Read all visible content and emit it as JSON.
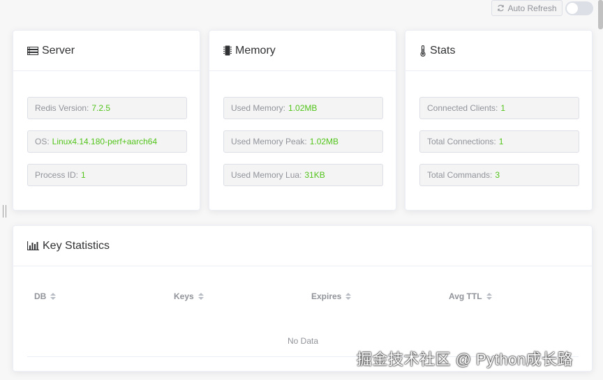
{
  "toolbar": {
    "auto_refresh_label": "Auto Refresh",
    "auto_refresh_enabled": false
  },
  "server": {
    "title": "Server",
    "items": [
      {
        "label": "Redis Version:",
        "value": "7.2.5"
      },
      {
        "label": "OS:",
        "value": "Linux4.14.180-perf+aarch64"
      },
      {
        "label": "Process ID:",
        "value": "1"
      }
    ]
  },
  "memory": {
    "title": "Memory",
    "items": [
      {
        "label": "Used Memory:",
        "value": "1.02MB"
      },
      {
        "label": "Used Memory Peak:",
        "value": "1.02MB"
      },
      {
        "label": "Used Memory Lua:",
        "value": "31KB"
      }
    ]
  },
  "stats": {
    "title": "Stats",
    "items": [
      {
        "label": "Connected Clients:",
        "value": "1"
      },
      {
        "label": "Total Connections:",
        "value": "1"
      },
      {
        "label": "Total Commands:",
        "value": "3"
      }
    ]
  },
  "key_statistics": {
    "title": "Key Statistics",
    "columns": [
      "DB",
      "Keys",
      "Expires",
      "Avg TTL"
    ],
    "empty_text": "No Data"
  },
  "watermark": "掘金技术社区 @ Python成长路",
  "colors": {
    "value_green": "#52c41a",
    "muted_text": "#909399",
    "border": "#dcdfe6"
  }
}
